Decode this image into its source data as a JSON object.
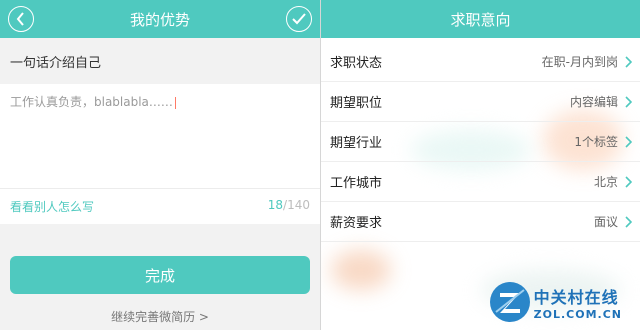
{
  "left_panel": {
    "header": {
      "title": "我的优势",
      "back_icon": "chevron-left-icon",
      "confirm_icon": "checkmark-icon"
    },
    "section_label": "一句话介绍自己",
    "textarea": {
      "value": "工作认真负责，blablabla……"
    },
    "helper_link": "看看别人怎么写",
    "counter": {
      "current": "18",
      "separator": "/",
      "max": "140"
    },
    "submit_button": "完成",
    "secondary_link": "继续完善微简历 >"
  },
  "right_panel": {
    "header": {
      "title": "求职意向"
    },
    "rows": [
      {
        "label": "求职状态",
        "value": "在职-月内到岗"
      },
      {
        "label": "期望职位",
        "value": "内容编辑"
      },
      {
        "label": "期望行业",
        "value": "1个标签"
      },
      {
        "label": "工作城市",
        "value": "北京"
      },
      {
        "label": "薪资要求",
        "value": "面议"
      }
    ],
    "chevron_icon": "chevron-right-icon"
  },
  "watermark": {
    "name_cn": "中关村在线",
    "name_en": "ZOL.COM.CN"
  },
  "colors": {
    "accent": "#4fc9bf",
    "background": "#f2f2f2",
    "watermark": "#1f72b8"
  }
}
